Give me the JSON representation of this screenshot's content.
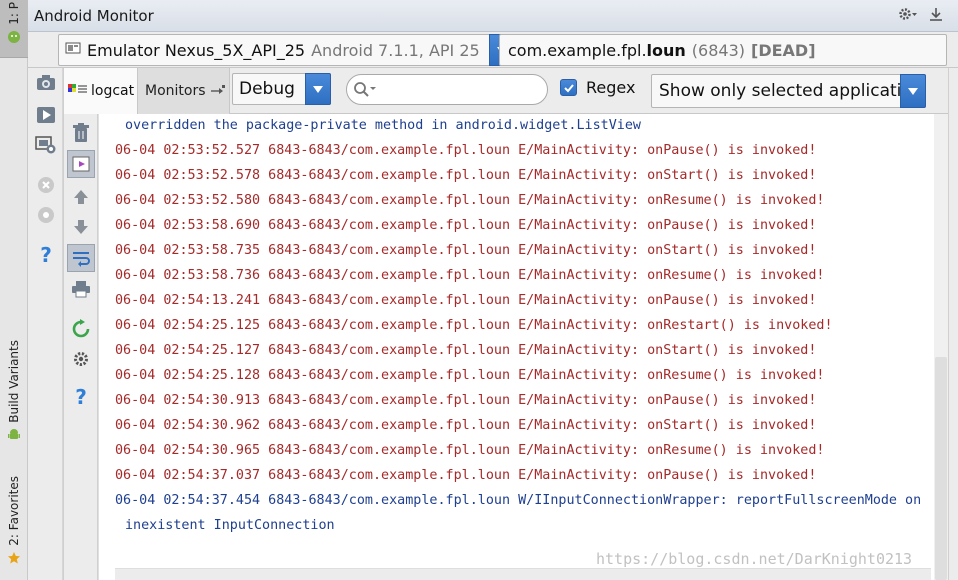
{
  "colors": {
    "accent_blue": "#2f6fc2",
    "log_error": "#a52a2a",
    "log_warn": "#1f3f8f",
    "android_green": "#7cb342"
  },
  "left_strip": {
    "project_tab": "1: P",
    "build_variants_tab": "Build Variants",
    "favorites_tab": "2: Favorites"
  },
  "titlebar": {
    "title": "Android Monitor"
  },
  "device_bar": {
    "device_name": "Emulator Nexus_5X_API_25",
    "device_version": "Android 7.1.1, API 25",
    "process_pkg_prefix": "com.example.fpl.",
    "process_pkg_bold": "loun",
    "process_pid": "(6843)",
    "process_state": "[DEAD]"
  },
  "filter_bar": {
    "logcat_tab": "logcat",
    "monitors_tab": "Monitors",
    "log_level": "Debug",
    "search_value": "",
    "regex_label": "Regex",
    "regex_checked": true,
    "filter_option": "Show only selected application"
  },
  "log": {
    "lines": [
      {
        "type": "W",
        "indent": true,
        "text": "overridden the package-private method in android.widget.ListView"
      },
      {
        "type": "E",
        "indent": false,
        "text": "06-04 02:53:52.527 6843-6843/com.example.fpl.loun E/MainActivity: onPause() is invoked!"
      },
      {
        "type": "E",
        "indent": false,
        "text": "06-04 02:53:52.578 6843-6843/com.example.fpl.loun E/MainActivity: onStart() is invoked!"
      },
      {
        "type": "E",
        "indent": false,
        "text": "06-04 02:53:52.580 6843-6843/com.example.fpl.loun E/MainActivity: onResume() is invoked!"
      },
      {
        "type": "E",
        "indent": false,
        "text": "06-04 02:53:58.690 6843-6843/com.example.fpl.loun E/MainActivity: onPause() is invoked!"
      },
      {
        "type": "E",
        "indent": false,
        "text": "06-04 02:53:58.735 6843-6843/com.example.fpl.loun E/MainActivity: onStart() is invoked!"
      },
      {
        "type": "E",
        "indent": false,
        "text": "06-04 02:53:58.736 6843-6843/com.example.fpl.loun E/MainActivity: onResume() is invoked!"
      },
      {
        "type": "E",
        "indent": false,
        "text": "06-04 02:54:13.241 6843-6843/com.example.fpl.loun E/MainActivity: onPause() is invoked!"
      },
      {
        "type": "E",
        "indent": false,
        "text": "06-04 02:54:25.125 6843-6843/com.example.fpl.loun E/MainActivity: onRestart() is invoked!"
      },
      {
        "type": "E",
        "indent": false,
        "text": "06-04 02:54:25.127 6843-6843/com.example.fpl.loun E/MainActivity: onStart() is invoked!"
      },
      {
        "type": "E",
        "indent": false,
        "text": "06-04 02:54:25.128 6843-6843/com.example.fpl.loun E/MainActivity: onResume() is invoked!"
      },
      {
        "type": "E",
        "indent": false,
        "text": "06-04 02:54:30.913 6843-6843/com.example.fpl.loun E/MainActivity: onPause() is invoked!"
      },
      {
        "type": "E",
        "indent": false,
        "text": "06-04 02:54:30.962 6843-6843/com.example.fpl.loun E/MainActivity: onStart() is invoked!"
      },
      {
        "type": "E",
        "indent": false,
        "text": "06-04 02:54:30.965 6843-6843/com.example.fpl.loun E/MainActivity: onResume() is invoked!"
      },
      {
        "type": "E",
        "indent": false,
        "text": "06-04 02:54:37.037 6843-6843/com.example.fpl.loun E/MainActivity: onPause() is invoked!"
      },
      {
        "type": "W",
        "indent": false,
        "text": "06-04 02:54:37.454 6843-6843/com.example.fpl.loun W/IInputConnectionWrapper: reportFullscreenMode on"
      },
      {
        "type": "W",
        "indent": true,
        "text": "inexistent InputConnection"
      }
    ]
  },
  "watermark": "https://blog.csdn.net/DarKnight0213"
}
